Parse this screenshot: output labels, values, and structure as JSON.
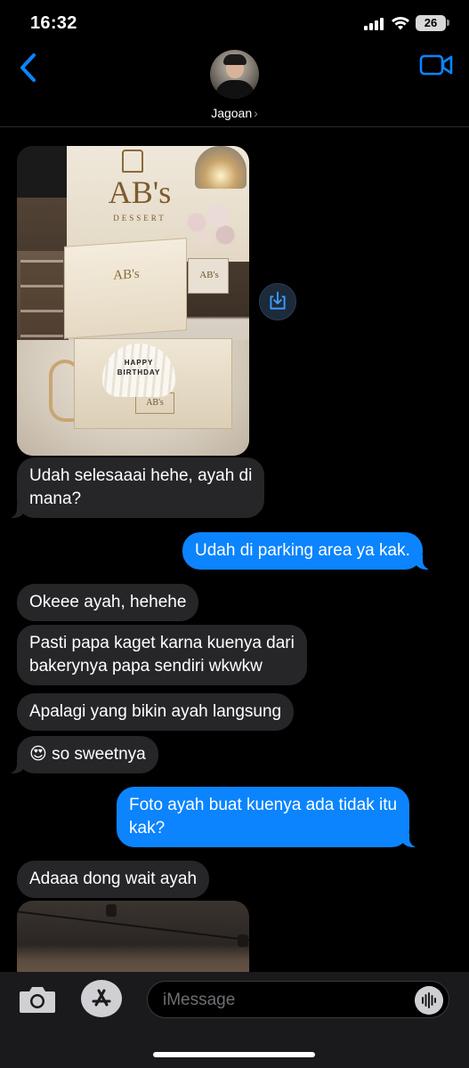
{
  "status_bar": {
    "time": "16:32",
    "battery": "26"
  },
  "header": {
    "contact_name": "Jagoan",
    "contact_chevron": "›"
  },
  "photo1": {
    "logo": "AB's",
    "logo_sub": "DESSERT",
    "lid_logo": "AB's",
    "bag_logo": "AB's",
    "box_label": "AB's",
    "cake_text_line1": "HAPPY",
    "cake_text_line2": "BIRTHDAY"
  },
  "messages": [
    {
      "side": "in",
      "text_lines": [
        "Udah selesaaai hehe, ayah di",
        "mana?"
      ]
    },
    {
      "side": "out",
      "text_lines": [
        "Udah di parking area ya kak."
      ]
    },
    {
      "side": "in",
      "text_lines": [
        "Okeee ayah, hehehe"
      ]
    },
    {
      "side": "in",
      "text_lines": [
        "Pasti papa kaget karna kuenya dari",
        "bakerynya papa sendiri wkwkw"
      ]
    },
    {
      "side": "in",
      "text_lines": [
        "Apalagi yang bikin ayah langsung"
      ]
    },
    {
      "side": "in",
      "text_lines": [
        "😍 so sweetnya"
      ]
    },
    {
      "side": "out",
      "text_lines": [
        "Foto ayah buat kuenya ada tidak itu",
        "kak?"
      ]
    },
    {
      "side": "in",
      "text_lines": [
        "Adaaa dong wait ayah"
      ]
    }
  ],
  "input": {
    "placeholder": "iMessage"
  },
  "icons": {
    "back": "chevron-left-icon",
    "video": "video-camera-icon",
    "download": "download-icon",
    "camera": "camera-icon",
    "appstore": "app-store-icon",
    "audio": "audio-waveform-icon"
  },
  "colors": {
    "accent": "#0b84fe",
    "incoming_bubble": "#262629",
    "background": "#000000"
  }
}
